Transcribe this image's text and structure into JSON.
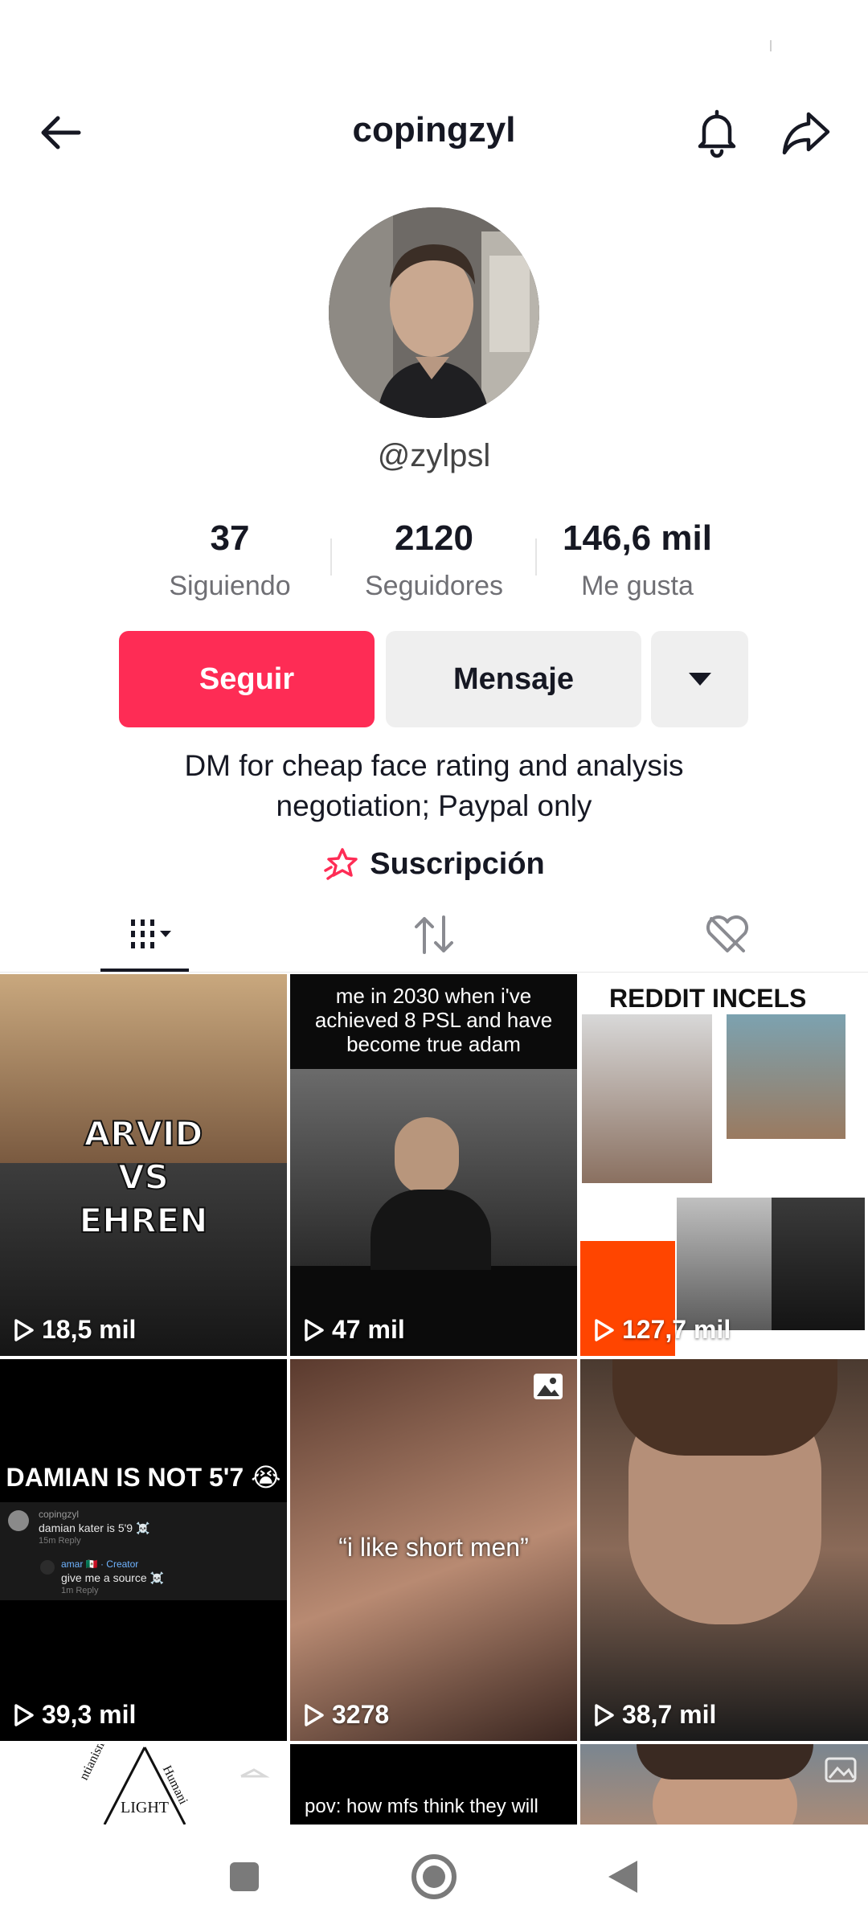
{
  "header": {
    "title": "copingzyl"
  },
  "profile": {
    "handle": "@zylpsl",
    "stats": [
      {
        "value": "37",
        "label": "Siguiendo"
      },
      {
        "value": "2120",
        "label": "Seguidores"
      },
      {
        "value": "146,6 mil",
        "label": "Me gusta"
      }
    ],
    "buttons": {
      "follow": "Seguir",
      "message": "Mensaje"
    },
    "bio_line1": "DM for cheap face rating and analysis",
    "bio_line2": "negotiation; Paypal only",
    "subscription": "Suscripción"
  },
  "grid": {
    "videos": [
      {
        "caption_lines": [
          "ARVID",
          "VS",
          "EHREN"
        ],
        "views": "18,5 mil"
      },
      {
        "caption": "me in 2030 when i've achieved 8 PSL and have become true adam",
        "views": "47 mil"
      },
      {
        "caption": "REDDIT INCELS",
        "views": "127,7 mil"
      },
      {
        "caption": "DAMIAN IS NOT 5'7 😭",
        "comment1_user": "copingzyl",
        "comment1_text": "damian kater is 5'9 ☠️",
        "comment1_meta": "15m   Reply",
        "comment2_user": "amar 🇲🇽 · Creator",
        "comment2_text": "give me a source ☠️",
        "comment2_meta": "1m   Reply",
        "views": "39,3 mil"
      },
      {
        "caption": "“i like short men”",
        "views": "3278"
      },
      {
        "caption": "",
        "views": "38,7 mil"
      },
      {
        "logo_text": "LIGHT",
        "logo_left": "ntianism",
        "logo_right": "Humani"
      },
      {
        "caption": "pov: how mfs think they will"
      },
      {
        "caption": ""
      }
    ]
  },
  "colors": {
    "accent": "#fe2c55",
    "text": "#161823",
    "secondary_text": "#6f6f74",
    "button_bg": "#efefef"
  }
}
